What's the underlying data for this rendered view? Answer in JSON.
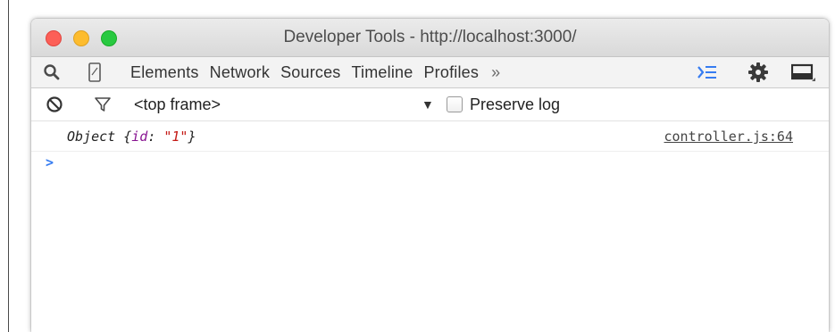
{
  "window": {
    "title": "Developer Tools - http://localhost:3000/"
  },
  "toolbar": {
    "left_icons": [
      "search-icon",
      "device-mode-icon"
    ],
    "tabs": [
      {
        "label": "Elements"
      },
      {
        "label": "Network"
      },
      {
        "label": "Sources"
      },
      {
        "label": "Timeline"
      },
      {
        "label": "Profiles"
      }
    ],
    "more_label": "»",
    "right_icons": [
      "console-drawer-icon",
      "settings-gear-icon",
      "dock-side-icon"
    ],
    "accent_color": "#367cf1"
  },
  "console_toolbar": {
    "clear_icon": "clear-console-icon",
    "filter_icon": "filter-icon",
    "context": "<top frame>",
    "dropdown_arrow": "▼",
    "preserve_log_label": "Preserve log",
    "preserve_log_checked": false
  },
  "console": {
    "entries": [
      {
        "prefix": "Object {",
        "prop_name": "id",
        "separator": ": ",
        "prop_value": "\"1\"",
        "suffix": "}",
        "source": "controller.js:64"
      }
    ],
    "prompt_symbol": ">",
    "prompt_value": ""
  }
}
